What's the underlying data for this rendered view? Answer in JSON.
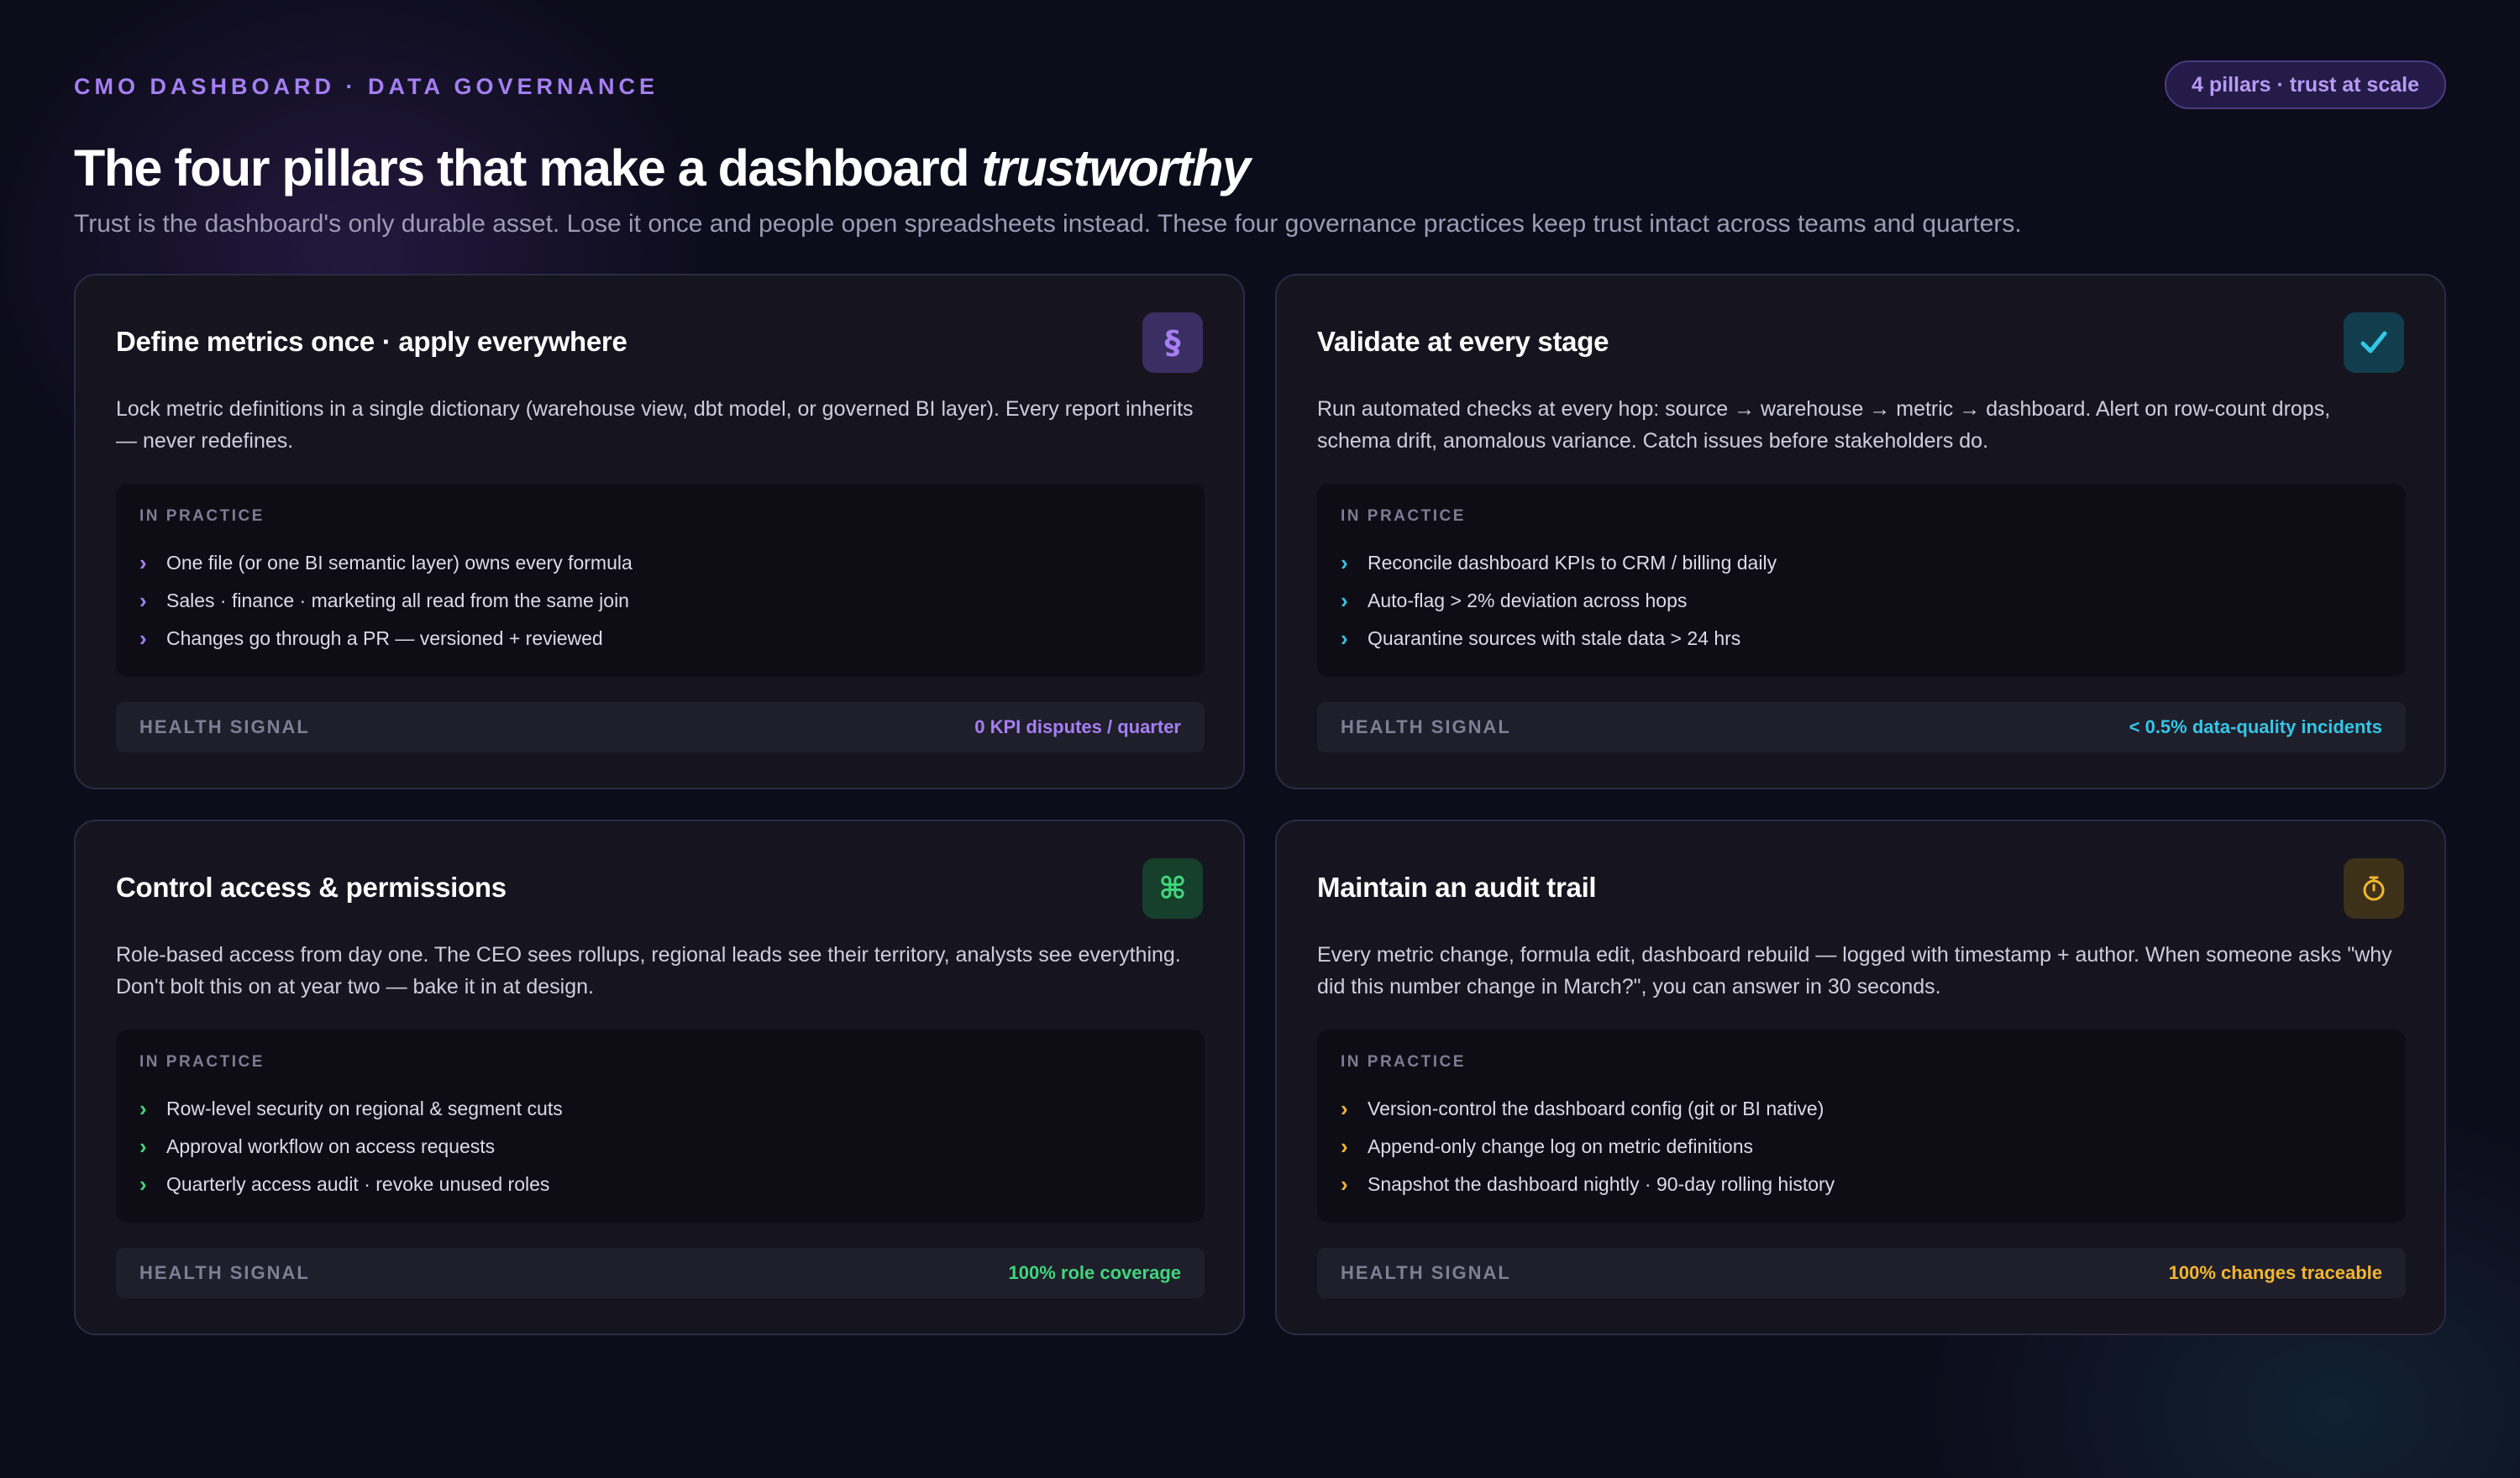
{
  "header": {
    "eyebrow": "CMO DASHBOARD · DATA GOVERNANCE",
    "pill": "4 pillars · trust at scale",
    "title_main": "The four pillars that make a dashboard ",
    "title_emphasis": "trustworthy",
    "subtitle": "Trust is the dashboard's only durable asset. Lose it once and people open spreadsheets instead. These four governance practices keep trust intact across teams and quarters."
  },
  "labels": {
    "in_practice": "IN PRACTICE",
    "health_signal": "HEALTH SIGNAL"
  },
  "pillars": [
    {
      "title": "Define metrics once · apply everywhere",
      "icon": "section-sign-icon",
      "icon_glyph": "§",
      "accent": "#a57ff2",
      "badge_bg": "#3a2e63",
      "desc": "Lock metric definitions in a single dictionary (warehouse view, dbt model, or governed BI layer). Every report inherits — never redefines.",
      "practices": [
        "One file (or one BI semantic layer) owns every formula",
        "Sales · finance · marketing all read from the same join",
        "Changes go through a PR — versioned + reviewed"
      ],
      "health_value": "0 KPI disputes / quarter"
    },
    {
      "title": "Validate at every stage",
      "icon": "checkmark-icon",
      "icon_glyph": "✓",
      "accent": "#34c6e6",
      "badge_bg": "#123d4c",
      "desc": "Run automated checks at every hop: source → warehouse → metric → dashboard. Alert on row-count drops, schema drift, anomalous variance. Catch issues before stakeholders do.",
      "practices": [
        "Reconcile dashboard KPIs to CRM / billing daily",
        "Auto-flag > 2% deviation across hops",
        "Quarantine sources with stale data > 24 hrs"
      ],
      "health_value": "< 0.5% data-quality incidents"
    },
    {
      "title": "Control access & permissions",
      "icon": "command-key-icon",
      "icon_glyph": "⌘",
      "accent": "#3fd67c",
      "badge_bg": "#163f2c",
      "desc": "Role-based access from day one. The CEO sees rollups, regional leads see their territory, analysts see everything. Don't bolt this on at year two — bake it in at design.",
      "practices": [
        "Row-level security on regional & segment cuts",
        "Approval workflow on access requests",
        "Quarterly access audit · revoke unused roles"
      ],
      "health_value": "100% role coverage"
    },
    {
      "title": "Maintain an audit trail",
      "icon": "stopwatch-icon",
      "icon_glyph": "⏱",
      "accent": "#f2b630",
      "badge_bg": "#3d3219",
      "desc": "Every metric change, formula edit, dashboard rebuild — logged with timestamp + author. When someone asks \"why did this number change in March?\", you can answer in 30 seconds.",
      "practices": [
        "Version-control the dashboard config (git or BI native)",
        "Append-only change log on metric definitions",
        "Snapshot the dashboard nightly · 90-day rolling history"
      ],
      "health_value": "100% changes traceable"
    }
  ]
}
